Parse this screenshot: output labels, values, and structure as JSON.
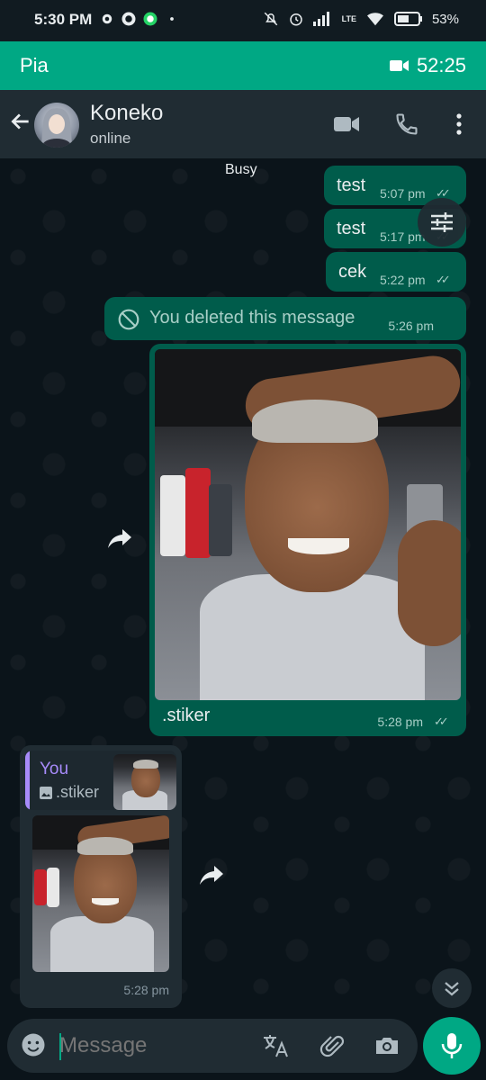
{
  "status_bar": {
    "time": "5:30 PM",
    "battery": "53%",
    "network": "LTE",
    "icons": [
      "gear-icon",
      "whatsapp-icon",
      "whatsapp-business-icon",
      "dot-icon",
      "mute-icon",
      "alarm-icon",
      "signal-icon",
      "lte-signal-icon",
      "wifi-icon",
      "battery-icon"
    ]
  },
  "call_bar": {
    "name": "Pia",
    "duration": "52:25",
    "icon": "video-camera-icon"
  },
  "header": {
    "contact_name": "Koneko",
    "contact_status": "online",
    "icons": [
      "back-arrow-icon",
      "video-call-icon",
      "phone-icon",
      "more-vert-icon"
    ]
  },
  "chat": {
    "busy_label": "Busy",
    "messages": [
      {
        "type": "text",
        "text": "test",
        "time": "5:07 pm",
        "ticks": "✓✓"
      },
      {
        "type": "text",
        "text": "test",
        "time": "5:17 pm",
        "ticks": "✓✓"
      },
      {
        "type": "text",
        "text": "cek",
        "time": "5:22 pm",
        "ticks": "✓✓"
      },
      {
        "type": "deleted",
        "text": "You deleted this message",
        "time": "5:26 pm"
      },
      {
        "type": "image",
        "caption": ".stiker",
        "time": "5:28 pm",
        "ticks": "✓✓"
      },
      {
        "type": "received_image",
        "quote_author": "You",
        "quote_text": ".stiker",
        "time": "5:28 pm"
      }
    ]
  },
  "composer": {
    "placeholder": "Message",
    "icons": [
      "emoji-icon",
      "translate-icon",
      "attach-icon",
      "camera-icon",
      "mic-icon"
    ]
  },
  "colors": {
    "accent": "#00a884",
    "outgoing_bubble": "#005c4b",
    "incoming_bubble": "#202c33",
    "background": "#0b141a",
    "quote_accent": "#a78bfa"
  }
}
